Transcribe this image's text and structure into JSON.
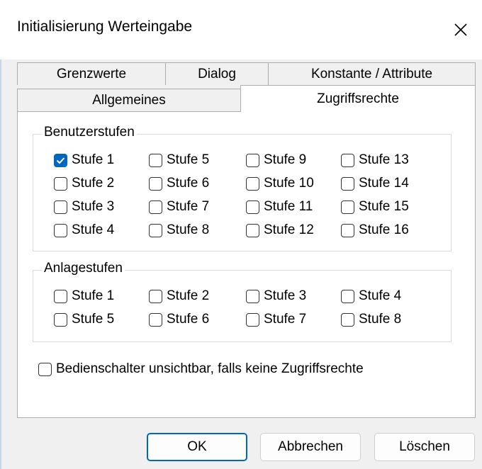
{
  "window": {
    "title": "Initialisierung Werteingabe"
  },
  "tabs": {
    "row_back": [
      "Grenzwerte",
      "Dialog",
      "Konstante / Attribute"
    ],
    "row_front": [
      "Allgemeines",
      "Zugriffsrechte"
    ],
    "active": "Zugriffsrechte"
  },
  "benutzerstufen": {
    "title": "Benutzerstufen",
    "items": [
      {
        "label": "Stufe 1",
        "checked": true
      },
      {
        "label": "Stufe 2",
        "checked": false
      },
      {
        "label": "Stufe 3",
        "checked": false
      },
      {
        "label": "Stufe 4",
        "checked": false
      },
      {
        "label": "Stufe 5",
        "checked": false
      },
      {
        "label": "Stufe 6",
        "checked": false
      },
      {
        "label": "Stufe 7",
        "checked": false
      },
      {
        "label": "Stufe 8",
        "checked": false
      },
      {
        "label": "Stufe 9",
        "checked": false
      },
      {
        "label": "Stufe 10",
        "checked": false
      },
      {
        "label": "Stufe 11",
        "checked": false
      },
      {
        "label": "Stufe 12",
        "checked": false
      },
      {
        "label": "Stufe 13",
        "checked": false
      },
      {
        "label": "Stufe 14",
        "checked": false
      },
      {
        "label": "Stufe 15",
        "checked": false
      },
      {
        "label": "Stufe 16",
        "checked": false
      }
    ]
  },
  "anlagestufen": {
    "title": "Anlagestufen",
    "items": [
      {
        "label": "Stufe 1",
        "checked": false
      },
      {
        "label": "Stufe 5",
        "checked": false
      },
      {
        "label": "Stufe 2",
        "checked": false
      },
      {
        "label": "Stufe 6",
        "checked": false
      },
      {
        "label": "Stufe 3",
        "checked": false
      },
      {
        "label": "Stufe 7",
        "checked": false
      },
      {
        "label": "Stufe 4",
        "checked": false
      },
      {
        "label": "Stufe 8",
        "checked": false
      }
    ]
  },
  "options": {
    "hide_controls_label": "Bedienschalter unsichtbar, falls keine Zugriffsrechte",
    "hide_controls_checked": false
  },
  "buttons": {
    "ok": "OK",
    "cancel": "Abbrechen",
    "delete": "Löschen"
  },
  "colors": {
    "accent": "#0067c0"
  }
}
